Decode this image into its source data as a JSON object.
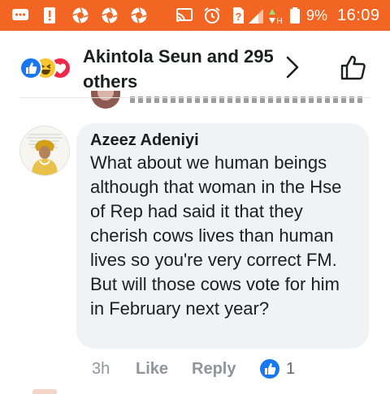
{
  "status_bar": {
    "battery_percent": "9%",
    "time": "16:09",
    "background_color": "#f26522",
    "icons": [
      "messages-icon",
      "alert-icon",
      "aperture-icon",
      "aperture-icon",
      "aperture-icon",
      "cast-icon",
      "alarm-icon",
      "no-sim-icon",
      "signal-icon",
      "battery-icon"
    ]
  },
  "header": {
    "reactors_text": "Akintola Seun and 295 others",
    "reaction_icons": [
      "like-reaction-icon",
      "haha-reaction-icon",
      "love-reaction-icon"
    ]
  },
  "comment": {
    "author": "Azeez Adeniyi",
    "text": "What about we human beings although that woman in the Hse of Rep had said it that they cherish cows lives than human lives so you're very correct FM. But will those cows vote for him in February next year?",
    "time": "3h",
    "like_label": "Like",
    "reply_label": "Reply",
    "reaction_count": "1"
  },
  "colors": {
    "brand_blue": "#1877f2",
    "bubble_bg": "#f0f2f5",
    "meta_gray": "#90949c"
  }
}
